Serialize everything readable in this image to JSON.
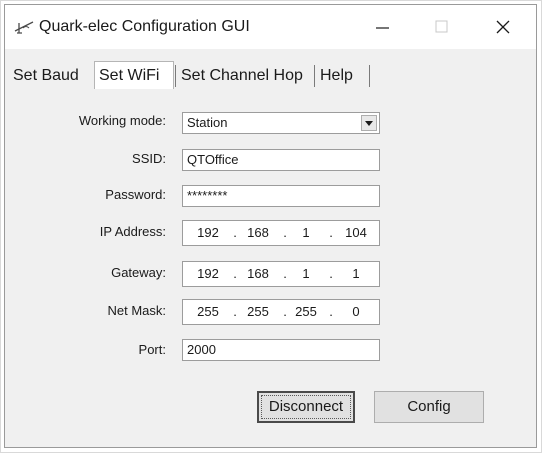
{
  "window": {
    "title": "Quark-elec Configuration GUI"
  },
  "tabs": [
    {
      "label": "Set Baud",
      "active": false
    },
    {
      "label": "Set WiFi",
      "active": true
    },
    {
      "label": "Set Channel Hop",
      "active": false
    },
    {
      "label": "Help",
      "active": false
    }
  ],
  "form": {
    "working_mode": {
      "label": "Working mode:",
      "value": "Station"
    },
    "ssid": {
      "label": "SSID:",
      "value": "QTOffice"
    },
    "password": {
      "label": "Password:",
      "value": "********"
    },
    "ip_address": {
      "label": "IP Address:",
      "octets": [
        "192",
        "168",
        "1",
        "104"
      ]
    },
    "gateway": {
      "label": "Gateway:",
      "octets": [
        "192",
        "168",
        "1",
        "1"
      ]
    },
    "net_mask": {
      "label": "Net Mask:",
      "octets": [
        "255",
        "255",
        "255",
        "0"
      ]
    },
    "port": {
      "label": "Port:",
      "value": "2000"
    }
  },
  "buttons": {
    "disconnect": "Disconnect",
    "config": "Config"
  },
  "ip_separator": "."
}
